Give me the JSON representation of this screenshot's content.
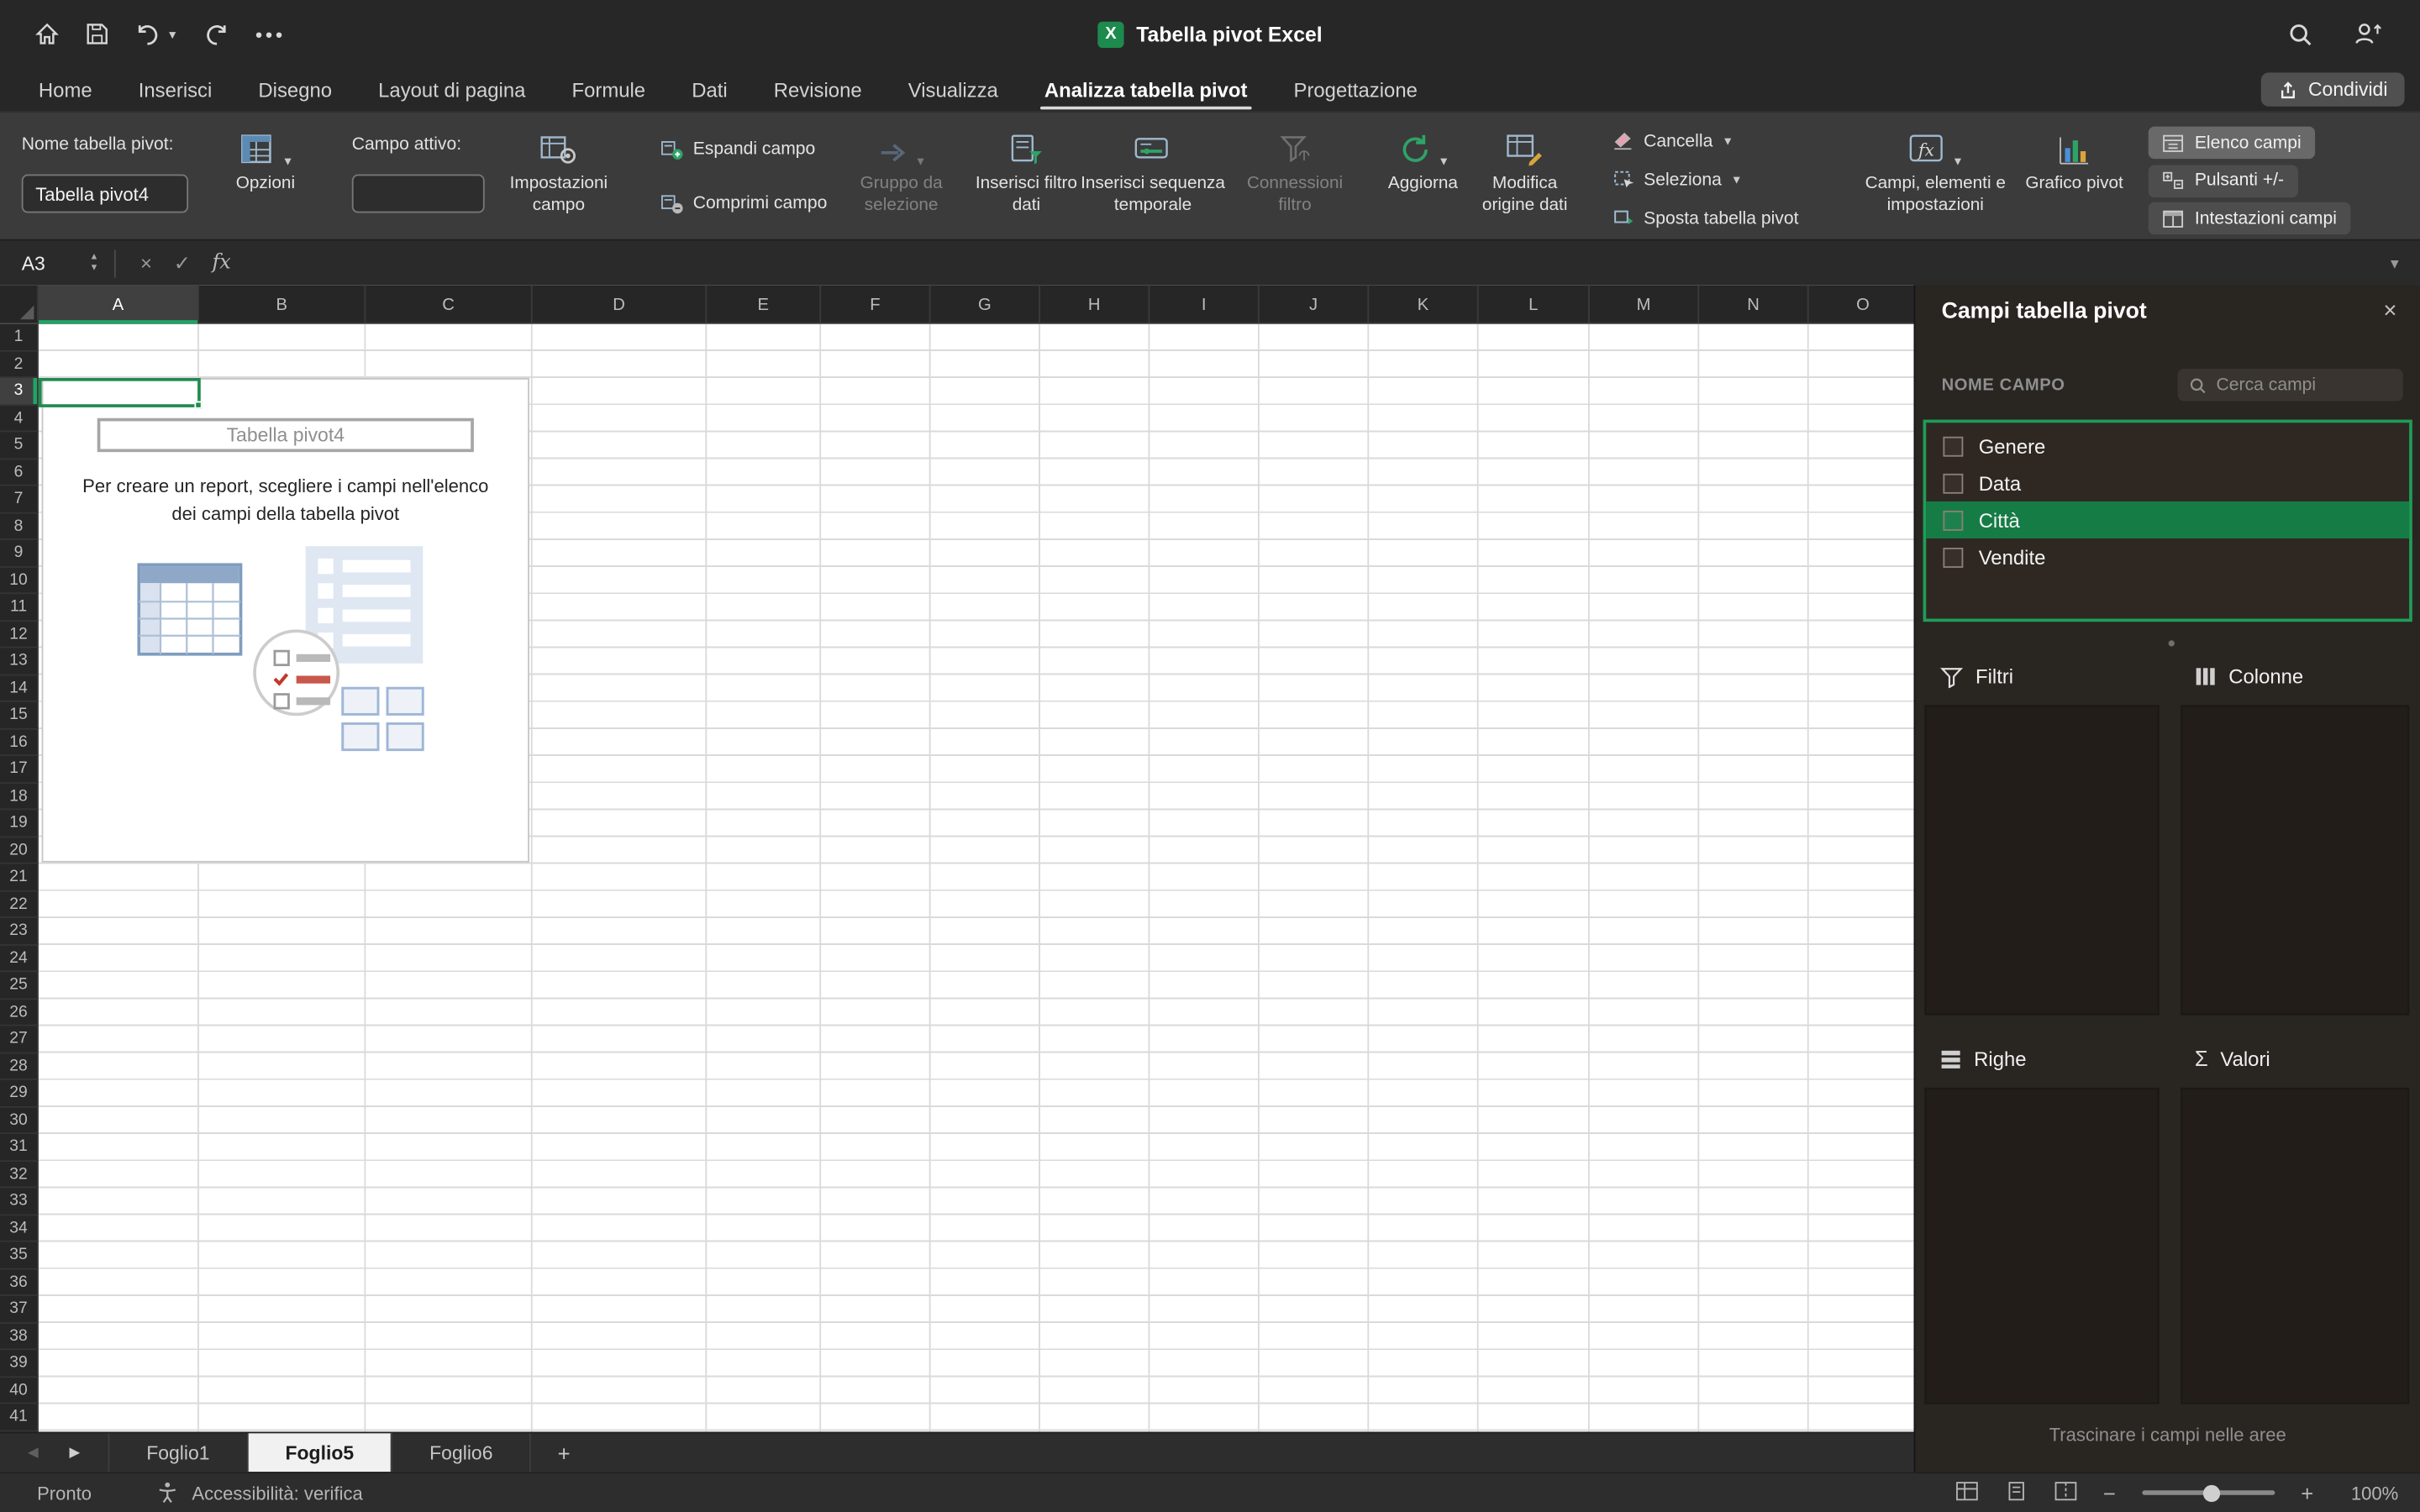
{
  "titlebar": {
    "title": "Tabella pivot Excel",
    "app_icon_letter": "X",
    "share_label": "Condividi"
  },
  "tabs": {
    "items": [
      "Home",
      "Inserisci",
      "Disegno",
      "Layout di pagina",
      "Formule",
      "Dati",
      "Revisione",
      "Visualizza",
      "Analizza tabella pivot",
      "Progettazione"
    ],
    "active": "Analizza tabella pivot"
  },
  "ribbon": {
    "pivot_name_label": "Nome tabella pivot:",
    "pivot_name_value": "Tabella pivot4",
    "options": "Opzioni",
    "active_field_label": "Campo attivo:",
    "field_settings": "Impostazioni campo",
    "expand_field": "Espandi campo",
    "collapse_field": "Comprimi campo",
    "group_from_selection": "Gruppo da selezione",
    "insert_slicer": "Inserisci filtro dati",
    "insert_timeline": "Inserisci sequenza temporale",
    "filter_connections": "Connessioni filtro",
    "refresh": "Aggiorna",
    "change_data_source": "Modifica origine dati",
    "clear": "Cancella",
    "select": "Seleziona",
    "move_pivottable": "Sposta tabella pivot",
    "fields_items_sets": "Campi, elementi e impostazioni",
    "pivot_chart": "Grafico pivot",
    "field_list": "Elenco campi",
    "plus_minus_buttons": "Pulsanti +/-",
    "field_headers": "Intestazioni campi"
  },
  "formula_bar": {
    "cell_reference": "A3",
    "fx_label": "fx"
  },
  "grid": {
    "columns": [
      "A",
      "B",
      "C",
      "D",
      "E",
      "F",
      "G",
      "H",
      "I",
      "J",
      "K",
      "L",
      "M",
      "N",
      "O"
    ],
    "rows": [
      "1",
      "2",
      "3",
      "4",
      "5",
      "6",
      "7",
      "8",
      "9",
      "10",
      "11",
      "12",
      "13",
      "14",
      "15",
      "16",
      "17",
      "18",
      "19",
      "20",
      "21",
      "22",
      "23",
      "24",
      "25",
      "26",
      "27",
      "28",
      "29",
      "30",
      "31",
      "32",
      "33",
      "34",
      "35",
      "36",
      "37",
      "38",
      "39",
      "40",
      "41"
    ],
    "selected_cell": "A3",
    "selected_column": "A",
    "selected_row": "3"
  },
  "placeholder": {
    "title": "Tabella pivot4",
    "message": "Per creare un report, scegliere i campi nell'elenco dei campi della tabella pivot"
  },
  "pane": {
    "title": "Campi tabella pivot",
    "section_label": "NOME CAMPO",
    "search_placeholder": "Cerca campi",
    "fields": [
      {
        "name": "Genere",
        "checked": false,
        "selected": false
      },
      {
        "name": "Data",
        "checked": false,
        "selected": false
      },
      {
        "name": "Città",
        "checked": false,
        "selected": true
      },
      {
        "name": "Vendite",
        "checked": false,
        "selected": false
      }
    ],
    "areas": {
      "filters": "Filtri",
      "columns": "Colonne",
      "rows": "Righe",
      "values": "Valori"
    },
    "hint": "Trascinare i campi nelle aree"
  },
  "sheet_tabs": {
    "items": [
      "Foglio1",
      "Foglio5",
      "Foglio6"
    ],
    "active": "Foglio5"
  },
  "status_bar": {
    "ready": "Pronto",
    "accessibility": "Accessibilità: verifica",
    "zoom": "100%"
  },
  "colors": {
    "accent_green": "#1f9d58",
    "selection_green": "#157c46",
    "excel_brand": "#1d8a4e"
  }
}
